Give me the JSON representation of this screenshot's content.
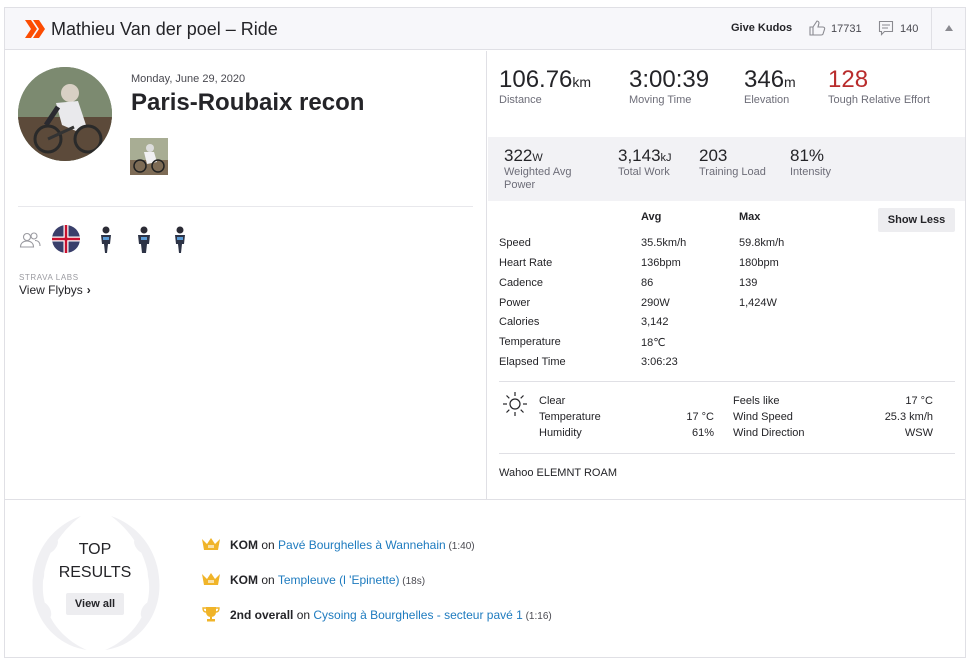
{
  "header": {
    "title": "Mathieu Van der poel – Ride",
    "give_kudos": "Give Kudos",
    "kudos_count": "17731",
    "comment_count": "140"
  },
  "activity": {
    "date": "Monday, June 29, 2020",
    "title": "Paris-Roubaix recon"
  },
  "labs": {
    "label": "STRAVA LABS",
    "flybys": "View Flybys"
  },
  "summary": [
    {
      "value": "106.76",
      "unit": "km",
      "label": "Distance"
    },
    {
      "value": "3:00:39",
      "unit": "",
      "label": "Moving Time"
    },
    {
      "value": "346",
      "unit": "m",
      "label": "Elevation"
    },
    {
      "value": "128",
      "unit": "",
      "label": "Tough Relative Effort"
    }
  ],
  "secondary": [
    {
      "value": "322",
      "unit": "W",
      "label": "Weighted Avg Power"
    },
    {
      "value": "3,143",
      "unit": "kJ",
      "label": "Total Work"
    },
    {
      "value": "203",
      "unit": "",
      "label": "Training Load"
    },
    {
      "value": "81%",
      "unit": "",
      "label": "Intensity"
    }
  ],
  "details": {
    "avg_header": "Avg",
    "max_header": "Max",
    "show_less": "Show Less",
    "rows": [
      {
        "label": "Speed",
        "avg": "35.5km/h",
        "max": "59.8km/h"
      },
      {
        "label": "Heart Rate",
        "avg": "136bpm",
        "max": "180bpm"
      },
      {
        "label": "Cadence",
        "avg": "86",
        "max": "139"
      },
      {
        "label": "Power",
        "avg": "290W",
        "max": "1,424W"
      },
      {
        "label": "Calories",
        "avg": "3,142",
        "max": ""
      },
      {
        "label": "Temperature",
        "avg": "18℃",
        "max": ""
      },
      {
        "label": "Elapsed Time",
        "avg": "3:06:23",
        "max": ""
      }
    ]
  },
  "weather": {
    "condition": "Clear",
    "temperature_label": "Temperature",
    "temperature": "17 °C",
    "humidity_label": "Humidity",
    "humidity": "61%",
    "feels_like_label": "Feels like",
    "feels_like": "17 °C",
    "wind_speed_label": "Wind Speed",
    "wind_speed": "25.3 km/h",
    "wind_direction_label": "Wind Direction",
    "wind_direction": "WSW"
  },
  "device": "Wahoo ELEMNT ROAM",
  "top_results": {
    "title_line1": "TOP",
    "title_line2": "RESULTS",
    "view_all": "View all",
    "items": [
      {
        "icon": "crown-icon",
        "badge": "KOM",
        "on": " on ",
        "segment": "Pavé Bourghelles à Wannehain",
        "time": " (1:40)"
      },
      {
        "icon": "crown-icon",
        "badge": "KOM",
        "on": " on ",
        "segment": "Templeuve (l 'Epinette)",
        "time": " (18s)"
      },
      {
        "icon": "trophy-icon",
        "badge": "2nd overall",
        "on": " on ",
        "segment": "Cysoing à Bourghelles - secteur pavé 1",
        "time": " (1:16)"
      }
    ]
  },
  "colors": {
    "brand_orange": "#fc4c02",
    "relative_effort_red": "#b92c2c",
    "link_blue": "#1e7bbf",
    "crown_gold": "#f0b429"
  }
}
